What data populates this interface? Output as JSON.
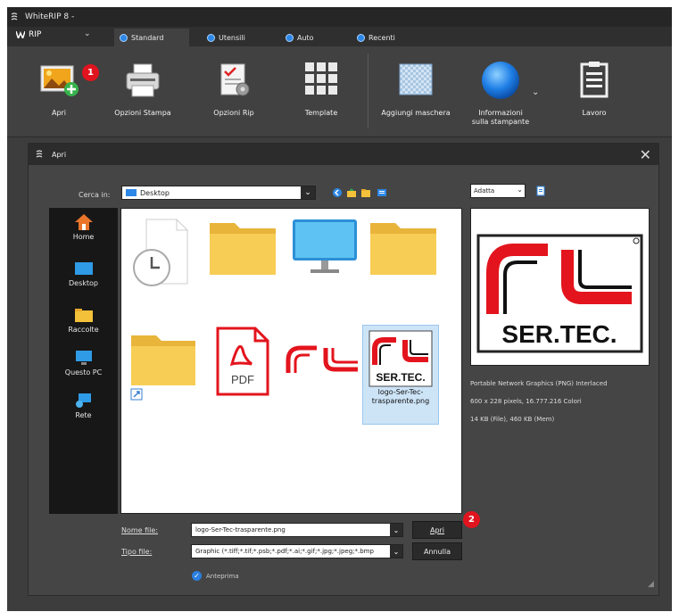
{
  "app": {
    "title": "WhiteRIP 8 -"
  },
  "menu": {
    "app_button": "RIP"
  },
  "tabs": [
    {
      "label": "Standard",
      "active": true
    },
    {
      "label": "Utensili",
      "active": false
    },
    {
      "label": "Auto",
      "active": false
    },
    {
      "label": "Recenti",
      "active": false
    }
  ],
  "ribbon": {
    "open": "Apri",
    "print_options": "Opzioni Stampa",
    "rip_options": "Opzioni Rip",
    "template": "Template",
    "add_mask": "Aggiungi maschera",
    "printer_info_line1": "Informazioni",
    "printer_info_line2": "sulla stampante",
    "jobs": "Lavoro"
  },
  "callouts": {
    "one": "1",
    "two": "2"
  },
  "dialog": {
    "title": "Apri",
    "look_in_label": "Cerca in:",
    "look_in_value": "Desktop",
    "places": [
      "Home",
      "Desktop",
      "Raccolte",
      "Questo PC",
      "Rete"
    ],
    "preview_mode": "Adatta",
    "selected_file": "logo-Ser-Tec-trasparente.png",
    "preview_info": [
      "Portable Network Graphics (PNG) Interlaced",
      "600 x 228 pixels, 16.777.216 Colori",
      "14 KB (File), 460 KB (Mem)"
    ],
    "filename_label": "Nome file:",
    "filename_value": "logo-Ser-Tec-trasparente.png",
    "filetype_label": "Tipo file:",
    "filetype_value": "Graphic (*.tiff;*.tif;*.psb;*.pdf;*.ai;*.gif;*.jpg;*.jpeg;*.bmp",
    "open_button": "Apri",
    "cancel_button": "Annulla",
    "preview_checkbox": "Anteprima"
  },
  "logo_text": "SER.TEC.",
  "colors": {
    "accent": "#2d87e6",
    "badge": "#e0141e",
    "logo_red": "#e3141d"
  }
}
